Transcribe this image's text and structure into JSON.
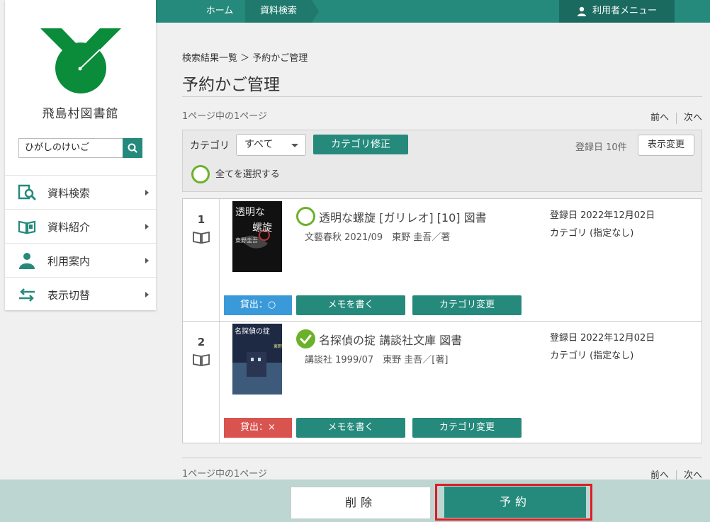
{
  "nav": {
    "home": "ホーム",
    "search": "資料検索",
    "user_menu": "利用者メニュー"
  },
  "sidebar": {
    "library_name": "飛島村図書館",
    "search_value": "ひがしのけいご",
    "items": [
      {
        "label": "資料検索",
        "icon": "search-book-icon"
      },
      {
        "label": "資料紹介",
        "icon": "open-book-icon"
      },
      {
        "label": "利用案内",
        "icon": "user-icon"
      },
      {
        "label": "表示切替",
        "icon": "switch-arrows-icon"
      }
    ]
  },
  "main": {
    "breadcrumb": "検索結果一覧 ＞ 予約かご管理",
    "title": "予約かご管理",
    "page_info": "1ページ中の1ページ",
    "pager_prev": "前へ",
    "pager_next": "次へ"
  },
  "filter": {
    "category_label": "カテゴリ",
    "category_value": "すべて",
    "category_fix": "カテゴリ修正",
    "reg_info": "登録日 10件",
    "display_change": "表示変更",
    "select_all": "全てを選択する"
  },
  "items": [
    {
      "num": "1",
      "title": "透明な螺旋 [ガリレオ] [10] 図書",
      "publisher": "文藝春秋 2021/09　東野 圭吾／著",
      "reg_date": "登録日 2022年12月02日",
      "category": "カテゴリ (指定なし)",
      "loan": "貸出：○",
      "loan_status": "available",
      "checked": false,
      "memo": "メモを書く",
      "cat_change": "カテゴリ変更",
      "cover_text": [
        "透明な",
        "螺旋",
        "東野圭吾"
      ]
    },
    {
      "num": "2",
      "title": "名探偵の掟 講談社文庫 図書",
      "publisher": "講談社 1999/07　東野 圭吾／[著]",
      "reg_date": "登録日 2022年12月02日",
      "category": "カテゴリ (指定なし)",
      "loan": "貸出：×",
      "loan_status": "unavailable",
      "checked": true,
      "memo": "メモを書く",
      "cat_change": "カテゴリ変更",
      "cover_text": [
        "名探偵の掟",
        "東野圭吾"
      ]
    }
  ],
  "footer": {
    "delete": "削除",
    "reserve": "予約"
  },
  "colors": {
    "accent": "#258a7c",
    "check_green": "#6cb12a",
    "loan_ok": "#3a9ad9",
    "loan_ng": "#d9534f",
    "highlight": "#e01b24"
  }
}
